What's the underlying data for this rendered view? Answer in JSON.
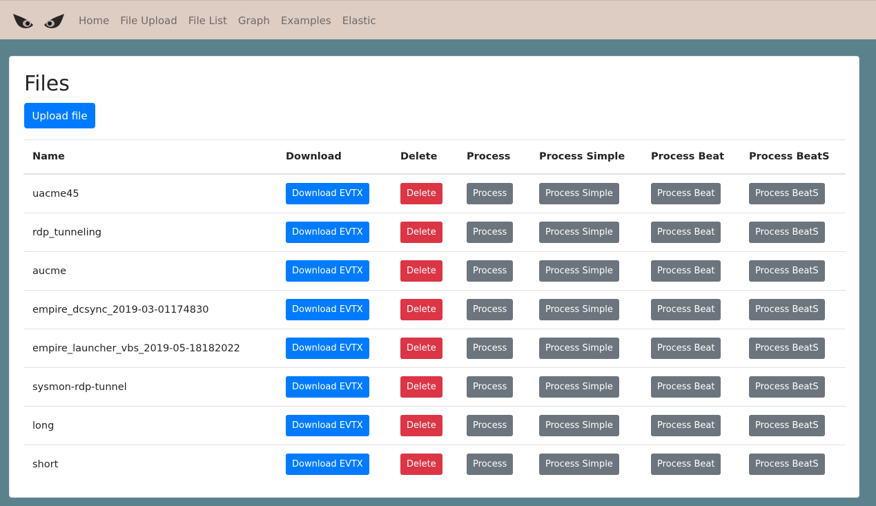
{
  "nav": {
    "links": [
      "Home",
      "File Upload",
      "File List",
      "Graph",
      "Examples",
      "Elastic"
    ]
  },
  "page": {
    "title": "Files",
    "upload_label": "Upload file"
  },
  "table": {
    "headers": [
      "Name",
      "Download",
      "Delete",
      "Process",
      "Process Simple",
      "Process Beat",
      "Process BeatS"
    ],
    "buttons": {
      "download": "Download EVTX",
      "delete": "Delete",
      "process": "Process",
      "process_simple": "Process Simple",
      "process_beat": "Process Beat",
      "process_beats": "Process BeatS"
    },
    "rows": [
      {
        "name": "uacme45"
      },
      {
        "name": "rdp_tunneling"
      },
      {
        "name": "aucme"
      },
      {
        "name": "empire_dcsync_2019-03-01174830"
      },
      {
        "name": "empire_launcher_vbs_2019-05-18182022"
      },
      {
        "name": "sysmon-rdp-tunnel"
      },
      {
        "name": "long"
      },
      {
        "name": "short"
      }
    ]
  },
  "colors": {
    "navbar_bg": "#decdc3",
    "page_bg": "#5b828c",
    "primary": "#007bff",
    "danger": "#dc3545",
    "secondary": "#6c757d"
  },
  "icons": {
    "brand": "owl-eyes-icon"
  }
}
